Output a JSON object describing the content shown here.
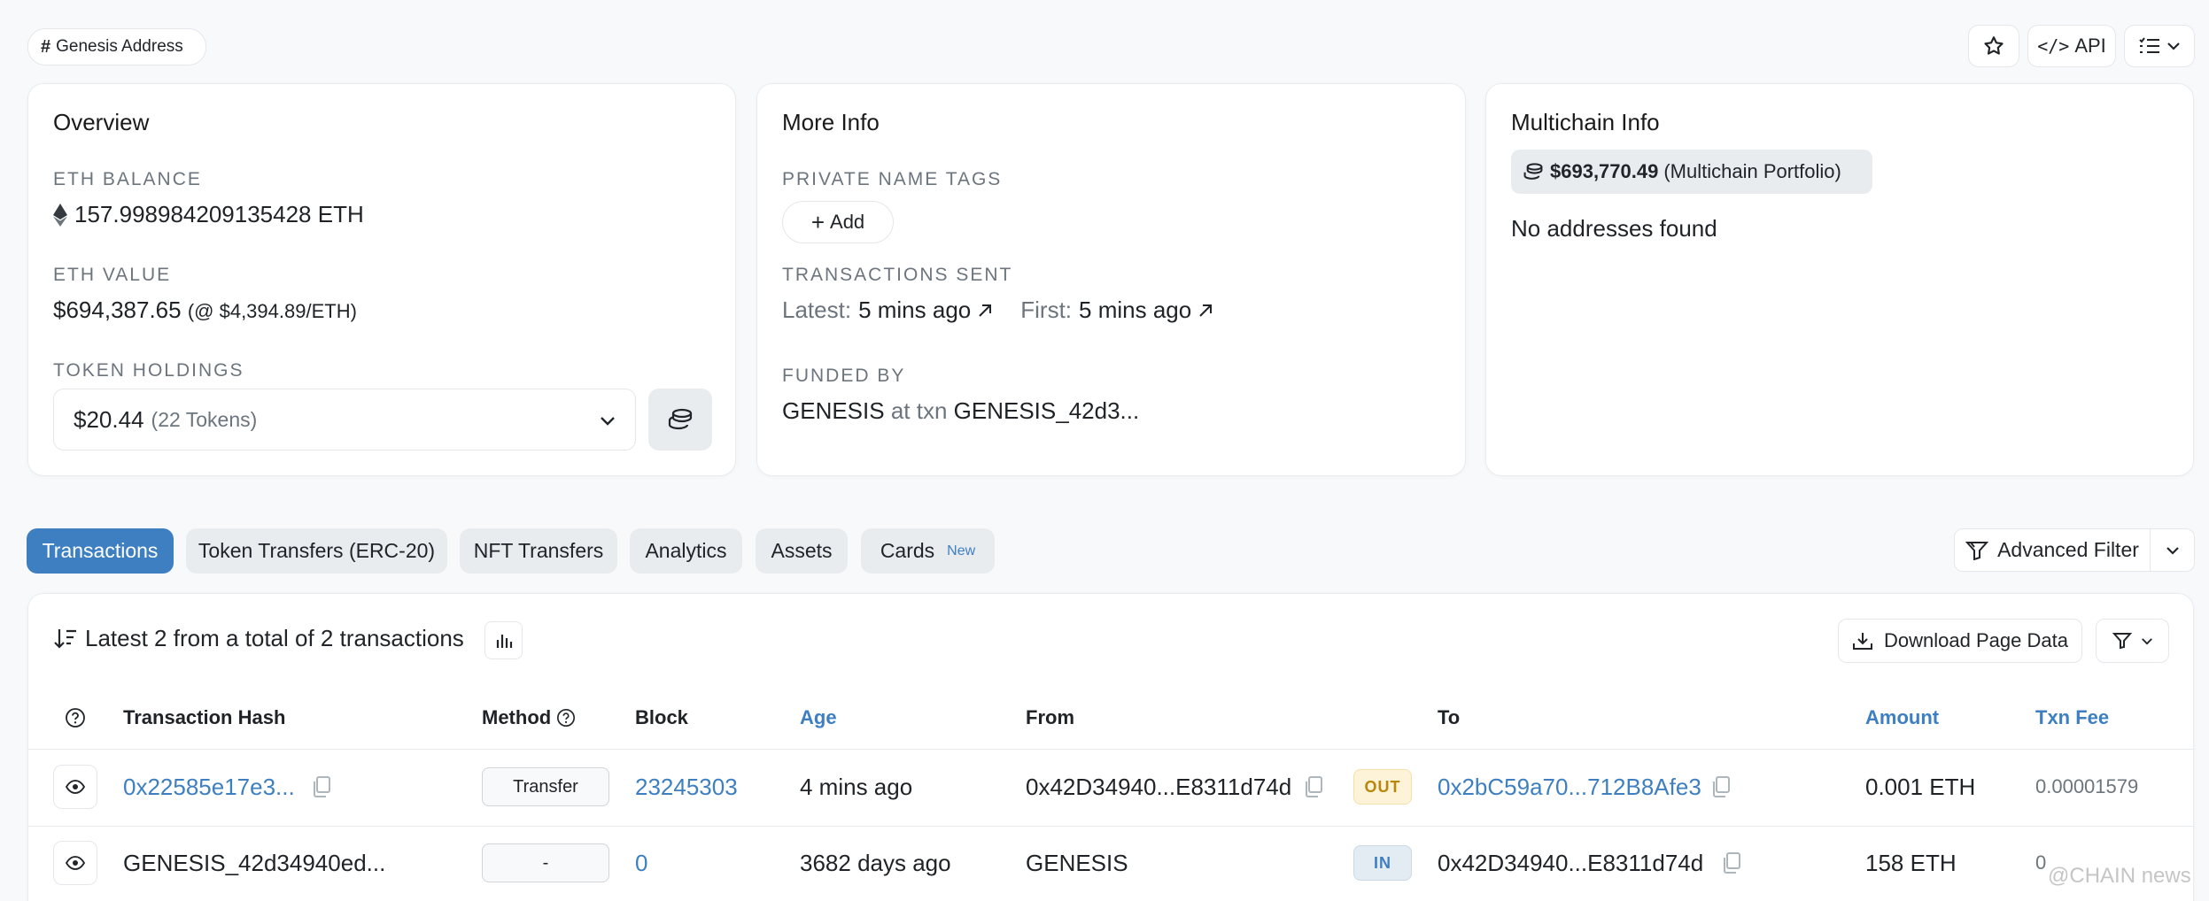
{
  "header": {
    "badge_label": "Genesis Address",
    "api_label": "API"
  },
  "overview": {
    "title": "Overview",
    "eth_balance_label": "ETH BALANCE",
    "eth_balance_value": "157.998984209135428 ETH",
    "eth_value_label": "ETH VALUE",
    "eth_value_usd": "$694,387.65",
    "eth_value_rate": "(@ $4,394.89/ETH)",
    "token_holdings_label": "TOKEN HOLDINGS",
    "token_holdings_value": "$20.44",
    "token_holdings_count": "(22 Tokens)"
  },
  "more_info": {
    "title": "More Info",
    "private_tags_label": "PRIVATE NAME TAGS",
    "add_label": "Add",
    "tx_sent_label": "TRANSACTIONS SENT",
    "latest_label": "Latest:",
    "latest_value": "5 mins ago",
    "first_label": "First:",
    "first_value": "5 mins ago",
    "funded_by_label": "FUNDED BY",
    "funded_by_source": "GENESIS",
    "funded_at": "at txn",
    "funded_txn": "GENESIS_42d3..."
  },
  "multichain": {
    "title": "Multichain Info",
    "portfolio_value": "$693,770.49",
    "portfolio_label": "(Multichain Portfolio)",
    "empty_message": "No addresses found"
  },
  "tabs": [
    {
      "label": "Transactions"
    },
    {
      "label": "Token Transfers (ERC-20)"
    },
    {
      "label": "NFT Transfers"
    },
    {
      "label": "Analytics"
    },
    {
      "label": "Assets"
    },
    {
      "label": "Cards",
      "badge": "New"
    }
  ],
  "advanced_filter_label": "Advanced Filter",
  "table": {
    "summary": "Latest 2 from a total of 2 transactions",
    "download_label": "Download Page Data",
    "columns": [
      "Transaction Hash",
      "Method",
      "Block",
      "Age",
      "From",
      "To",
      "Amount",
      "Txn Fee"
    ],
    "rows": [
      {
        "hash": "0x22585e17e3...",
        "method": "Transfer",
        "block": "23245303",
        "age": "4 mins ago",
        "from": "0x42D34940...E8311d74d",
        "direction": "OUT",
        "to": "0x2bC59a70...712B8Afe3",
        "amount": "0.001 ETH",
        "fee": "0.00001579"
      },
      {
        "hash": "GENESIS_42d34940ed...",
        "method": "-",
        "block": "0",
        "age": "3682 days ago",
        "from": "GENESIS",
        "direction": "IN",
        "to": "0x42D34940...E8311d74d",
        "amount": "158 ETH",
        "fee": "0"
      }
    ]
  },
  "watermark": "@CHAIN news",
  "colors": {
    "accent": "#3d7fc1",
    "out_badge_bg": "#fdf3d8",
    "out_badge_text": "#b8860b",
    "in_badge_bg": "#e3ecf3",
    "in_badge_text": "#3d7fc1"
  }
}
